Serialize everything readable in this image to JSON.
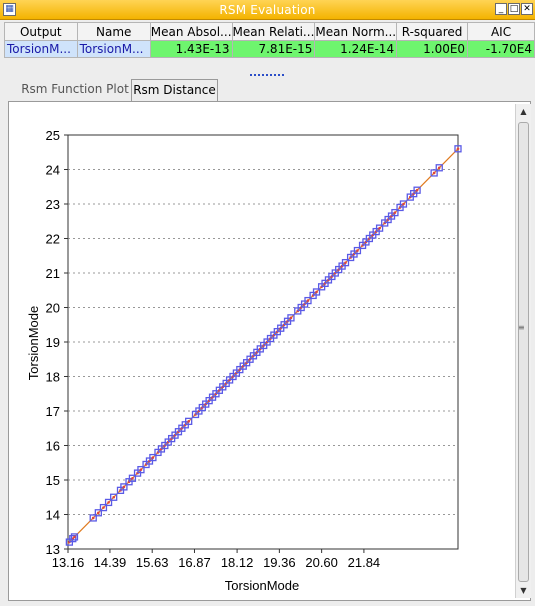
{
  "window": {
    "title": "RSM Evaluation",
    "app_icon": "grid-app-icon",
    "controls": {
      "minimize": "_",
      "maximize": "□",
      "close": "✕"
    },
    "accent": "#f4b300"
  },
  "grid": {
    "columns": [
      "Output",
      "Name",
      "Mean Absol...",
      "Mean Relati...",
      "Mean Norm...",
      "R-squared",
      "AIC"
    ],
    "row": [
      "TorsionM...",
      "TorsionM...",
      "1.43E-13",
      "7.81E-15",
      "1.24E-14",
      "1.00E0",
      "-1.70E4"
    ],
    "value_color": "#6ef56e",
    "name_color": "#cfe3fb"
  },
  "tabs": [
    {
      "label": "Rsm Function Plot",
      "active": false
    },
    {
      "label": "Rsm Distance",
      "active": true
    }
  ],
  "chart_data": {
    "type": "scatter",
    "xlabel": "TorsionMode",
    "ylabel": "TorsionMode",
    "xlim": [
      13.16,
      24.6
    ],
    "ylim": [
      13,
      25
    ],
    "x_ticks": [
      "13.16",
      "14.39",
      "15.63",
      "16.87",
      "18.12",
      "19.36",
      "20.60",
      "21.84"
    ],
    "y_ticks": [
      "13",
      "14",
      "15",
      "16",
      "17",
      "18",
      "19",
      "20",
      "21",
      "22",
      "23",
      "24",
      "25"
    ],
    "grid": "horizontal dashed",
    "legend": "none",
    "fit_line": [
      [
        13.16,
        13.16
      ],
      [
        24.6,
        24.6
      ]
    ],
    "fit_line_color": "#e07a1f",
    "marker_color": "#5a5ae6",
    "marker_center_color": "#e0453a",
    "points": [
      [
        13.2,
        13.2
      ],
      [
        13.3,
        13.3
      ],
      [
        13.35,
        13.35
      ],
      [
        13.9,
        13.9
      ],
      [
        14.05,
        14.05
      ],
      [
        14.2,
        14.2
      ],
      [
        14.35,
        14.35
      ],
      [
        14.5,
        14.5
      ],
      [
        14.7,
        14.7
      ],
      [
        14.8,
        14.8
      ],
      [
        14.95,
        14.95
      ],
      [
        15.05,
        15.05
      ],
      [
        15.2,
        15.2
      ],
      [
        15.3,
        15.3
      ],
      [
        15.45,
        15.45
      ],
      [
        15.55,
        15.55
      ],
      [
        15.65,
        15.65
      ],
      [
        15.8,
        15.8
      ],
      [
        15.9,
        15.9
      ],
      [
        16.0,
        16.0
      ],
      [
        16.1,
        16.1
      ],
      [
        16.2,
        16.2
      ],
      [
        16.3,
        16.3
      ],
      [
        16.4,
        16.4
      ],
      [
        16.5,
        16.5
      ],
      [
        16.6,
        16.6
      ],
      [
        16.7,
        16.7
      ],
      [
        16.9,
        16.9
      ],
      [
        17.0,
        17.0
      ],
      [
        17.1,
        17.1
      ],
      [
        17.2,
        17.2
      ],
      [
        17.3,
        17.3
      ],
      [
        17.4,
        17.4
      ],
      [
        17.5,
        17.5
      ],
      [
        17.6,
        17.6
      ],
      [
        17.7,
        17.7
      ],
      [
        17.8,
        17.8
      ],
      [
        17.9,
        17.9
      ],
      [
        18.0,
        18.0
      ],
      [
        18.1,
        18.1
      ],
      [
        18.2,
        18.2
      ],
      [
        18.3,
        18.3
      ],
      [
        18.4,
        18.4
      ],
      [
        18.5,
        18.5
      ],
      [
        18.6,
        18.6
      ],
      [
        18.7,
        18.7
      ],
      [
        18.8,
        18.8
      ],
      [
        18.9,
        18.9
      ],
      [
        19.0,
        19.0
      ],
      [
        19.1,
        19.1
      ],
      [
        19.2,
        19.2
      ],
      [
        19.3,
        19.3
      ],
      [
        19.4,
        19.4
      ],
      [
        19.5,
        19.5
      ],
      [
        19.6,
        19.6
      ],
      [
        19.7,
        19.7
      ],
      [
        19.9,
        19.9
      ],
      [
        20.0,
        20.0
      ],
      [
        20.1,
        20.1
      ],
      [
        20.2,
        20.2
      ],
      [
        20.35,
        20.35
      ],
      [
        20.45,
        20.45
      ],
      [
        20.6,
        20.6
      ],
      [
        20.7,
        20.7
      ],
      [
        20.8,
        20.8
      ],
      [
        20.9,
        20.9
      ],
      [
        21.0,
        21.0
      ],
      [
        21.1,
        21.1
      ],
      [
        21.2,
        21.2
      ],
      [
        21.3,
        21.3
      ],
      [
        21.45,
        21.45
      ],
      [
        21.55,
        21.55
      ],
      [
        21.65,
        21.65
      ],
      [
        21.8,
        21.8
      ],
      [
        21.9,
        21.9
      ],
      [
        22.0,
        22.0
      ],
      [
        22.1,
        22.1
      ],
      [
        22.2,
        22.2
      ],
      [
        22.3,
        22.3
      ],
      [
        22.45,
        22.45
      ],
      [
        22.55,
        22.55
      ],
      [
        22.65,
        22.65
      ],
      [
        22.75,
        22.75
      ],
      [
        22.9,
        22.9
      ],
      [
        23.0,
        23.0
      ],
      [
        23.2,
        23.2
      ],
      [
        23.3,
        23.3
      ],
      [
        23.4,
        23.4
      ],
      [
        23.9,
        23.9
      ],
      [
        24.05,
        24.05
      ],
      [
        24.6,
        24.6
      ]
    ]
  },
  "scrollbar": {
    "up": "▲",
    "down": "▼",
    "grip": "≡"
  }
}
